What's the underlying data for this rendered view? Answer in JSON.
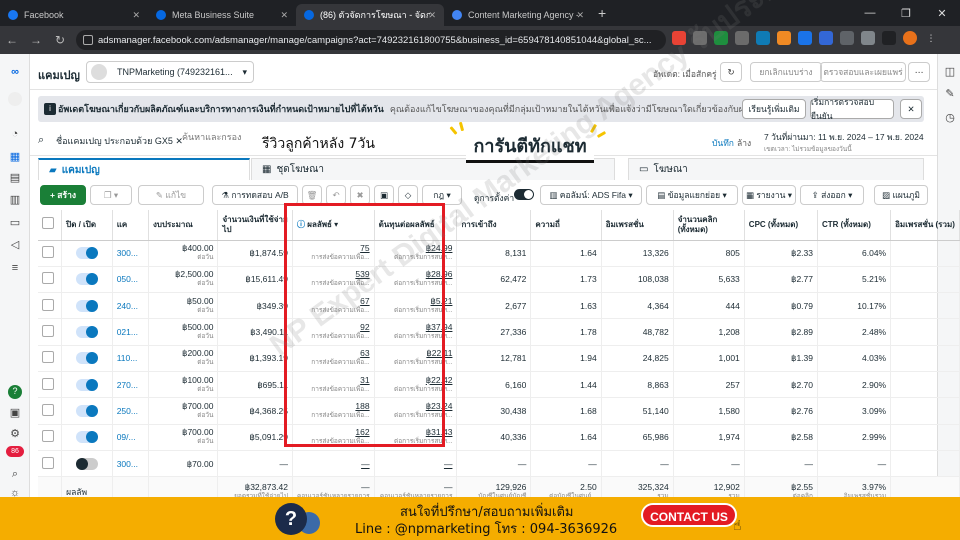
{
  "browser": {
    "tabs": [
      {
        "label": "Facebook",
        "color": "#1877f2"
      },
      {
        "label": "Meta Business Suite",
        "color": "#0668e1"
      },
      {
        "label": "(86) ตัวจัดการโฆษณา - จัดการโฆษณา",
        "color": "#0668e1"
      },
      {
        "label": "Content Marketing Agency - Co",
        "color": "#4285f4"
      }
    ],
    "url": "adsmanager.facebook.com/adsmanager/manage/campaigns?act=749232161800755&business_id=659478140851044&global_sc..."
  },
  "header": {
    "title": "แคมเปญ",
    "account": "TNPMarketing (749232161...",
    "updated": "อัพเดต: เมื่อสักครู่",
    "discard": "ยกเลิกแบบร่าง",
    "review": "ตรวจสอบและเผยแพร่"
  },
  "banner": {
    "title": "อัพเดตโฆษณาเกี่ยวกับผลิตภัณฑ์และบริการทางการเงินที่กำหนดเป้าหมายไปที่ไต้หวัน",
    "body": "คุณต้องแก้ไขโฆษณาของคุณที่มีกลุ่มเป้าหมายในไต้หวันเพื่อแจ้งว่ามีโฆษณาใดเกี่ยวข้องกับผลิตภัณฑ์และบริ...",
    "learn": "เรียนรู้เพิ่มเติม",
    "review": "เริ่มการตรวจสอบยืนยัน"
  },
  "search": {
    "chip": "ชื่อแคมเปญ ประกอบด้วย GX5",
    "placeholder": "ค้นหาและกรอง",
    "save": "บันทึก",
    "clear": "ล้าง",
    "date": "7 วันที่ผ่านมา: 11 พ.ย. 2024 – 17 พ.ย. 2024",
    "tz": "เขตเวลา: ไม่รวมข้อมูลของวันนี้"
  },
  "overlay": {
    "review_text": "รีวิวลูกค้าหลัง 7วัน",
    "headline": "การันตีทักแชท",
    "watermark": "NP Expert Digital Marketing Agency รับประกันรีวิวจริง"
  },
  "pagetabs": [
    "แคมเปญ",
    "ชุดโฆษณา",
    "โฆษณา"
  ],
  "toolbar": {
    "create": "+ สร้าง",
    "edit": "แก้ไข",
    "abtest": "การทดสอบ A/B",
    "more": "กฎ",
    "bysetting": "ดูการตั้งค่า",
    "columns": "คอลัมน์: ADS Fifa",
    "breakdown": "ข้อมูลแยกย่อย",
    "reports": "รายงาน",
    "export": "ส่งออก",
    "charts": "แผนภูมิ"
  },
  "table": {
    "headers": [
      "ปิด / เปิด",
      "แค",
      "งบประมาณ",
      "จำนวนเงินที่ใช้จ่ายไป",
      "ผลลัพธ์",
      "ต้นทุนต่อผลลัพธ์",
      "การเข้าถึง",
      "ความถี่",
      "อิมเพรสชั่น",
      "จำนวนคลิก (ทั้งหมด)",
      "CPC (ทั้งหมด)",
      "CTR (ทั้งหมด)",
      "อิมเพรสชั่น (รวม)"
    ],
    "rows": [
      {
        "id": "300...",
        "on": true,
        "budget": "฿400.00",
        "budget_sub": "ต่อวัน",
        "spent": "฿1,874.59",
        "results": "75",
        "results_sub": "การส่งข้อความเพื่อ...",
        "cpr": "฿24.99",
        "cpr_sub": "ต่อการเริ่มการสนท...",
        "reach": "8,131",
        "freq": "1.64",
        "impr": "13,326",
        "clicks": "805",
        "cpc": "฿2.33",
        "ctr": "6.04%"
      },
      {
        "id": "050...",
        "on": true,
        "budget": "฿2,500.00",
        "budget_sub": "ต่อวัน",
        "spent": "฿15,611.49",
        "results": "539",
        "results_sub": "การส่งข้อความเพื่อ...",
        "cpr": "฿28.96",
        "cpr_sub": "ต่อการเริ่มการสนท...",
        "reach": "62,472",
        "freq": "1.73",
        "impr": "108,038",
        "clicks": "5,633",
        "cpc": "฿2.77",
        "ctr": "5.21%"
      },
      {
        "id": "240...",
        "on": true,
        "budget": "฿50.00",
        "budget_sub": "ต่อวัน",
        "spent": "฿349.39",
        "results": "67",
        "results_sub": "การส่งข้อความเพื่อ...",
        "cpr": "฿5.21",
        "cpr_sub": "ต่อการเริ่มการสนท...",
        "reach": "2,677",
        "freq": "1.63",
        "impr": "4,364",
        "clicks": "444",
        "cpc": "฿0.79",
        "ctr": "10.17%"
      },
      {
        "id": "021...",
        "on": true,
        "budget": "฿500.00",
        "budget_sub": "ต่อวัน",
        "spent": "฿3,490.11",
        "results": "92",
        "results_sub": "การส่งข้อความเพื่อ...",
        "cpr": "฿37.94",
        "cpr_sub": "ต่อการเริ่มการสนท...",
        "reach": "27,336",
        "freq": "1.78",
        "impr": "48,782",
        "clicks": "1,208",
        "cpc": "฿2.89",
        "ctr": "2.48%"
      },
      {
        "id": "110...",
        "on": true,
        "budget": "฿200.00",
        "budget_sub": "ต่อวัน",
        "spent": "฿1,393.19",
        "results": "63",
        "results_sub": "การส่งข้อความเพื่อ...",
        "cpr": "฿22.11",
        "cpr_sub": "ต่อการเริ่มการสนท...",
        "reach": "12,781",
        "freq": "1.94",
        "impr": "24,825",
        "clicks": "1,001",
        "cpc": "฿1.39",
        "ctr": "4.03%"
      },
      {
        "id": "270...",
        "on": true,
        "budget": "฿100.00",
        "budget_sub": "ต่อวัน",
        "spent": "฿695.11",
        "results": "31",
        "results_sub": "การส่งข้อความเพื่อ...",
        "cpr": "฿22.42",
        "cpr_sub": "ต่อการเริ่มการสนท...",
        "reach": "6,160",
        "freq": "1.44",
        "impr": "8,863",
        "clicks": "257",
        "cpc": "฿2.70",
        "ctr": "2.90%"
      },
      {
        "id": "250...",
        "on": true,
        "budget": "฿700.00",
        "budget_sub": "ต่อวัน",
        "spent": "฿4,368.25",
        "results": "188",
        "results_sub": "การส่งข้อความเพื่อ...",
        "cpr": "฿23.24",
        "cpr_sub": "ต่อการเริ่มการสนท...",
        "reach": "30,438",
        "freq": "1.68",
        "impr": "51,140",
        "clicks": "1,580",
        "cpc": "฿2.76",
        "ctr": "3.09%"
      },
      {
        "id": "09/...",
        "on": true,
        "budget": "฿700.00",
        "budget_sub": "ต่อวัน",
        "spent": "฿5,091.29",
        "results": "162",
        "results_sub": "การส่งข้อความเพื่อ...",
        "cpr": "฿31.43",
        "cpr_sub": "ต่อการเริ่มการสนท...",
        "reach": "40,336",
        "freq": "1.64",
        "impr": "65,986",
        "clicks": "1,974",
        "cpc": "฿2.58",
        "ctr": "2.99%"
      },
      {
        "id": "300...",
        "on": false,
        "budget": "฿70.00",
        "budget_sub": "",
        "spent": "—",
        "results": "—",
        "results_sub": "",
        "cpr": "—",
        "cpr_sub": "",
        "reach": "—",
        "freq": "—",
        "impr": "—",
        "clicks": "—",
        "cpc": "—",
        "ctr": "—"
      }
    ],
    "total": {
      "label": "ผลลัพ",
      "spent": "฿32,873.42",
      "spent_sub": "ยอดรวมที่ใช้จ่ายไป",
      "results": "—",
      "results_sub": "คอนเวอร์ชันหลายรายการ",
      "cpr": "—",
      "cpr_sub": "คอนเวอร์ชันหลายรายการ",
      "reach": "129,926",
      "reach_sub": "บัญชีในศูนย์บัญชี",
      "freq": "2.50",
      "freq_sub": "ต่อบัญชีในศูนย์...",
      "impr": "325,324",
      "impr_sub": "รวม",
      "clicks": "12,902",
      "clicks_sub": "รวม",
      "cpc": "฿2.55",
      "cpc_sub": "ต่อคลิก",
      "ctr": "3.97%",
      "ctr_sub": "อิมเพรสชั่นรวม"
    }
  },
  "footer": {
    "line1": "สนใจที่ปรึกษา/สอบถามเพิ่มเติม",
    "line2": "Line : @npmarketing  โทร : 094-3636926",
    "contact": "CONTACT US"
  },
  "notif_count": "86"
}
